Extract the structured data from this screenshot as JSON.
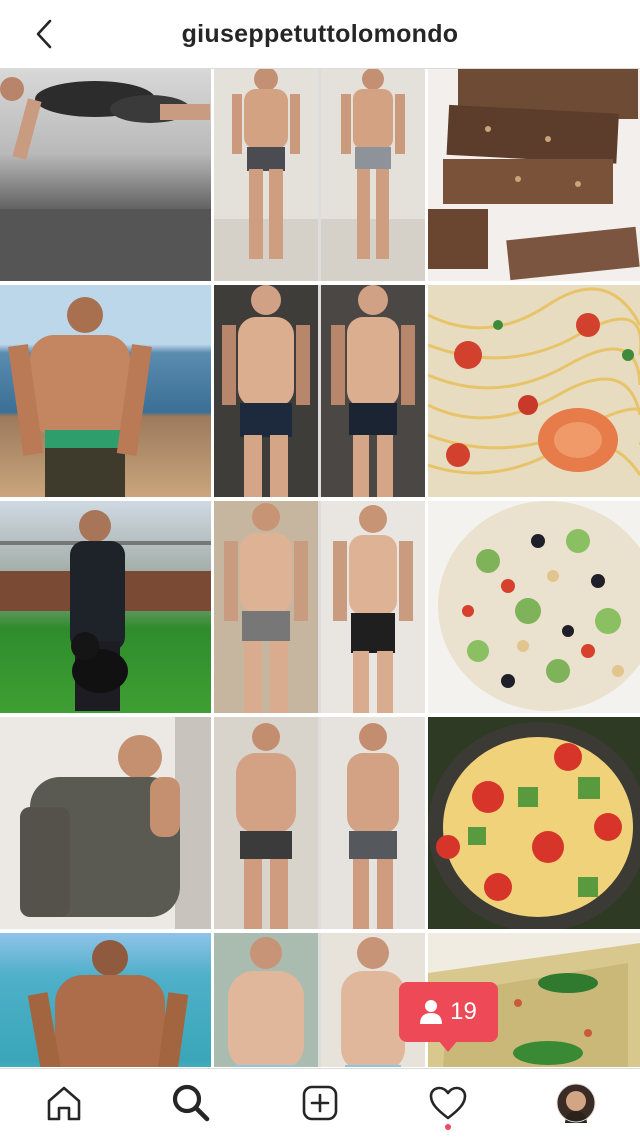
{
  "header": {
    "username": "giuseppetuttolomondo",
    "back_icon": "chevron-left-icon"
  },
  "grid": {
    "rows": [
      [
        "plank exercise photo",
        "before and after body comparison",
        "chocolate crisp bars"
      ],
      [
        "shirtless man by the sea",
        "before and after body comparison",
        "spaghetti with shrimp and tomatoes"
      ],
      [
        "man with dog in park",
        "before and after body comparison",
        "chickpea cucumber salad"
      ],
      [
        "man with backpack selfie",
        "before and after body comparison",
        "pasta salad with tomatoes"
      ],
      [
        "man in swimwear on beach",
        "before and after body comparison",
        "vegetable frittata slice"
      ]
    ]
  },
  "notification": {
    "icon": "person-icon",
    "count": "19",
    "color": "#ed4956"
  },
  "bottom_nav": {
    "items": [
      "home-icon",
      "search-icon",
      "add-post-icon",
      "activity-heart-icon",
      "profile-avatar"
    ],
    "active": "search-icon"
  },
  "colors": {
    "text": "#262626",
    "border": "#dbdbdb",
    "badge": "#ed4956"
  }
}
